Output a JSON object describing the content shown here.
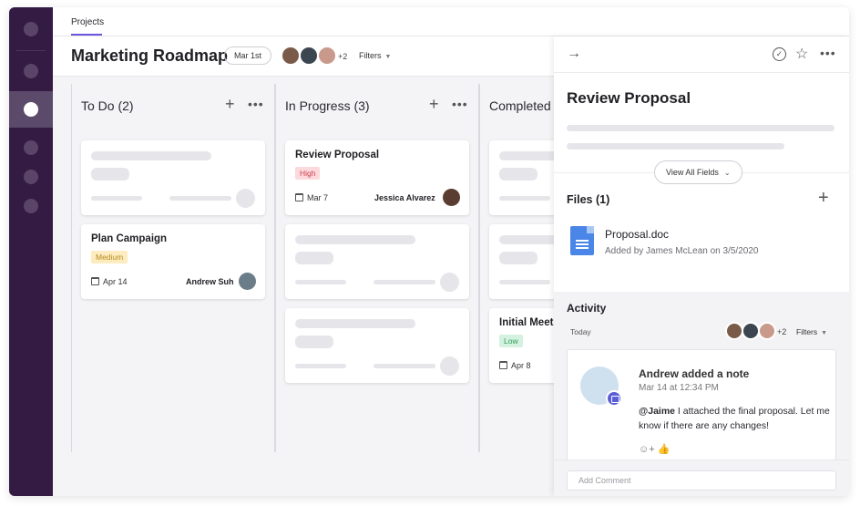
{
  "nav": {
    "tab": "Projects"
  },
  "header": {
    "title": "Marketing Roadmap",
    "date": "Mar 1st",
    "more_members": "+2",
    "filters": "Filters"
  },
  "columns": [
    {
      "title": "To Do (2)"
    },
    {
      "title": "In Progress (3)"
    },
    {
      "title": "Completed"
    }
  ],
  "cards": {
    "plan_campaign": {
      "title": "Plan Campaign",
      "priority": "Medium",
      "date": "Apr 14",
      "assignee": "Andrew Suh"
    },
    "review_proposal": {
      "title": "Review Proposal",
      "priority": "High",
      "date": "Mar 7",
      "assignee": "Jessica Alvarez"
    },
    "initial_meeting": {
      "title": "Initial Meet",
      "priority": "Low",
      "date": "Apr 8"
    }
  },
  "panel": {
    "title": "Review Proposal",
    "view_all": "View All Fields",
    "files_title": "Files (1)",
    "file": {
      "name": "Proposal.doc",
      "meta": "Added by James McLean on 3/5/2020"
    },
    "activity_title": "Activity",
    "today": "Today",
    "more_members": "+2",
    "filters": "Filters",
    "note": {
      "head": "Andrew added a note",
      "time": "Mar 14 at 12:34 PM",
      "mention": "@Jaime",
      "body": " I attached the final proposal. Let me know if there are any changes!"
    },
    "comment_placeholder": "Add Comment"
  },
  "colors": {
    "rail": "#331b43",
    "accent": "#6b56e0",
    "high": "#d04452",
    "medium": "#b58a1e",
    "low": "#2f9b5c"
  }
}
